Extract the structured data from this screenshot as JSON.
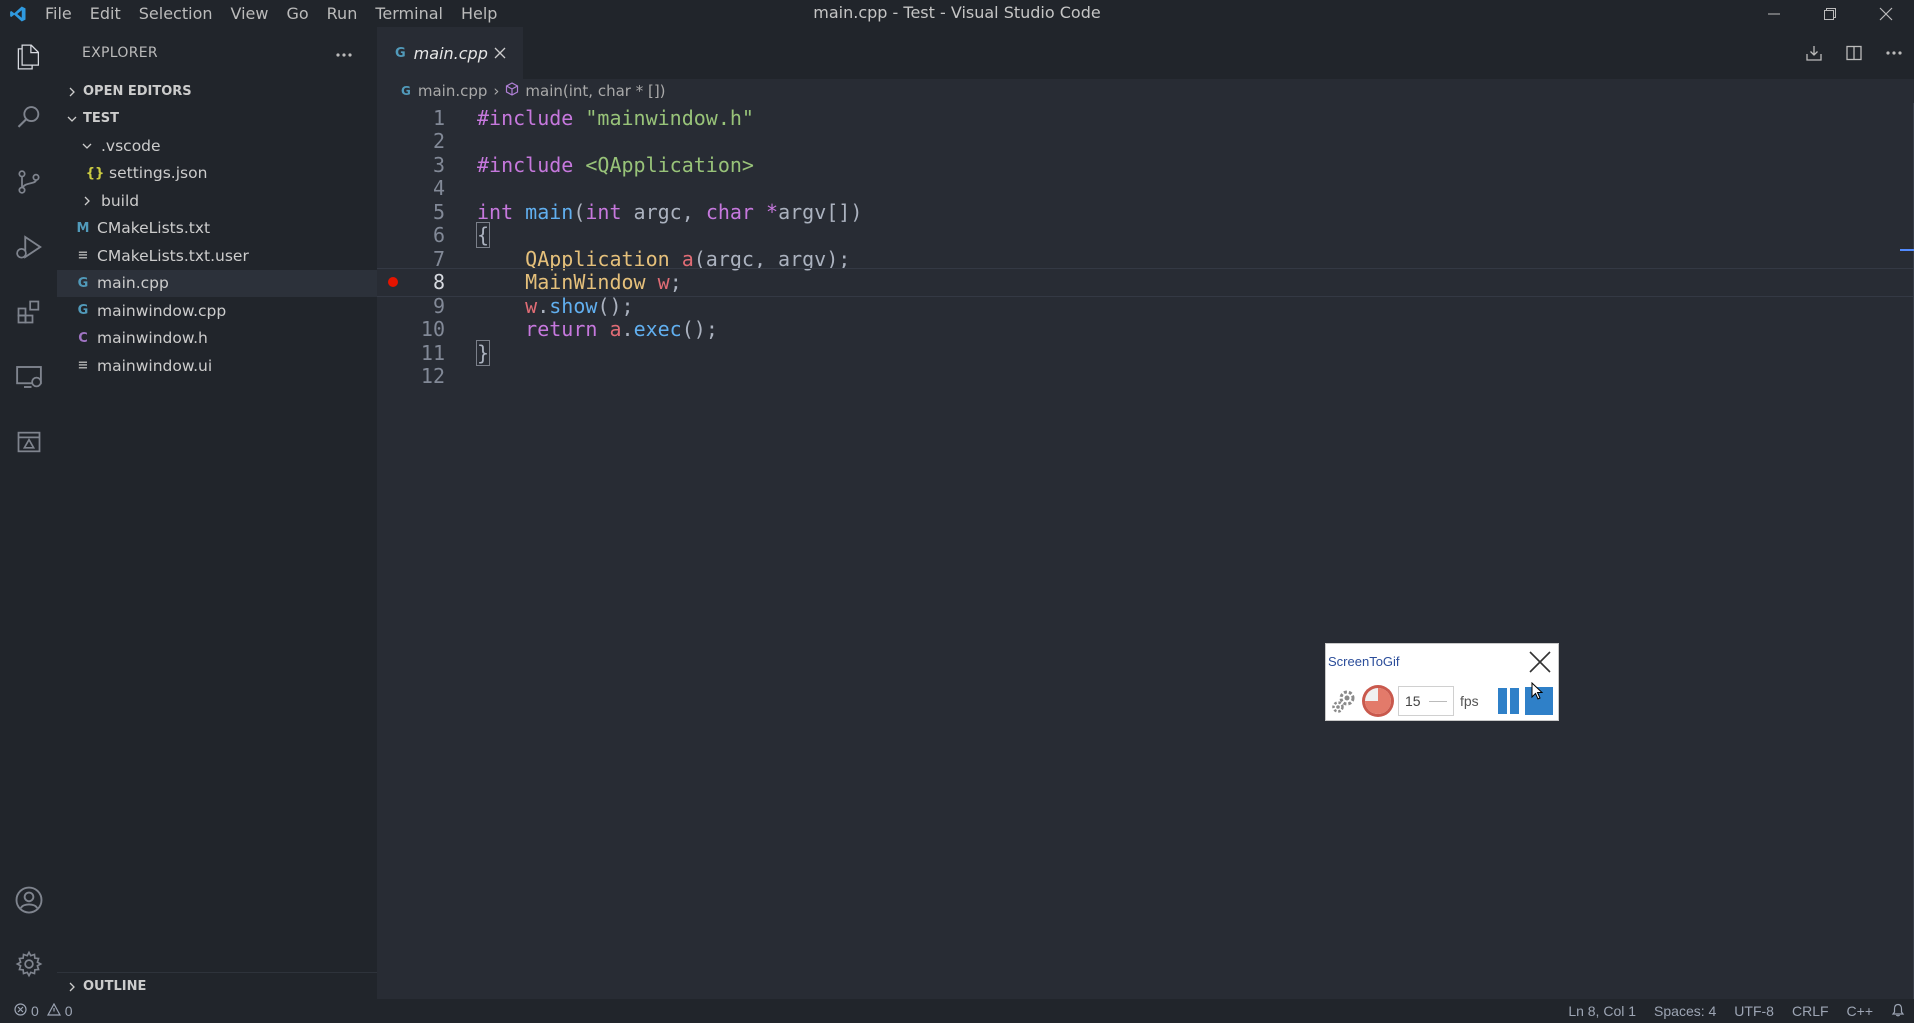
{
  "window": {
    "title": "main.cpp - Test - Visual Studio Code",
    "menus": [
      "File",
      "Edit",
      "Selection",
      "View",
      "Go",
      "Run",
      "Terminal",
      "Help"
    ]
  },
  "sidebar": {
    "title": "EXPLORER",
    "sections": {
      "open_editors": "OPEN EDITORS",
      "project": "TEST",
      "outline": "OUTLINE"
    },
    "files": [
      {
        "name": ".vscode",
        "icon": "folder-open-chevron"
      },
      {
        "name": "settings.json",
        "icon": "json-icon",
        "glyph": "{}"
      },
      {
        "name": "build",
        "icon": "folder-closed-chevron"
      },
      {
        "name": "CMakeLists.txt",
        "icon": "cmake-icon",
        "glyph": "M"
      },
      {
        "name": "CMakeLists.txt.user",
        "icon": "text-file-icon",
        "glyph": "≡"
      },
      {
        "name": "main.cpp",
        "icon": "cpp-icon",
        "glyph": "G"
      },
      {
        "name": "mainwindow.cpp",
        "icon": "cpp-icon",
        "glyph": "G"
      },
      {
        "name": "mainwindow.h",
        "icon": "c-header-icon",
        "glyph": "C"
      },
      {
        "name": "mainwindow.ui",
        "icon": "text-file-icon",
        "glyph": "≡"
      }
    ]
  },
  "editor": {
    "tab": {
      "label": "main.cpp",
      "glyph": "G"
    },
    "breadcrumb": {
      "file": "main.cpp",
      "symbol": "main(int, char * [])",
      "sep": "›"
    },
    "line_numbers": [
      "1",
      "2",
      "3",
      "4",
      "5",
      "6",
      "7",
      "8",
      "9",
      "10",
      "11",
      "12"
    ],
    "current_line": 8,
    "breakpoint_line": 8
  },
  "screentogif": {
    "title": "ScreenToGif",
    "fps_value": "15",
    "fps_label": "fps"
  },
  "status": {
    "errors": "0",
    "warnings": "0",
    "position": "Ln 8, Col 1",
    "spaces": "Spaces: 4",
    "encoding": "UTF-8",
    "eol": "CRLF",
    "language": "C++"
  },
  "colors": {
    "keyword": "#c678dd",
    "string": "#98c379",
    "type": "#e5c07b",
    "function": "#61afef",
    "variable": "#e06c75",
    "breakpoint": "#e51400",
    "accent": "#528bff"
  }
}
